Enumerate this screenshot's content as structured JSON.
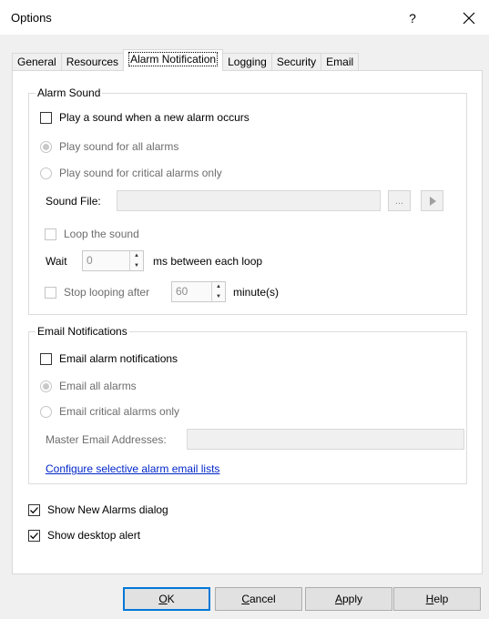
{
  "window": {
    "title": "Options",
    "help_label": "?"
  },
  "tabs": [
    {
      "label": "General"
    },
    {
      "label": "Resources"
    },
    {
      "label": "Alarm Notification"
    },
    {
      "label": "Logging"
    },
    {
      "label": "Security"
    },
    {
      "label": "Email"
    }
  ],
  "alarm_sound": {
    "group_label": "Alarm Sound",
    "play_sound_label": "Play a sound when a new alarm occurs",
    "play_sound_checked": false,
    "all_alarms_label": "Play sound for all alarms",
    "critical_only_label": "Play sound for critical alarms only",
    "sound_file_label": "Sound File:",
    "sound_file_value": "",
    "browse_label": "...",
    "play_icon": "play-icon",
    "loop_label": "Loop the sound",
    "wait_label": "Wait",
    "wait_value": "0",
    "ms_label": "ms between each loop",
    "stop_after_label": "Stop looping after",
    "stop_after_value": "60",
    "minutes_label": "minute(s)"
  },
  "email_notifications": {
    "group_label": "Email Notifications",
    "email_alarm_label": "Email alarm notifications",
    "email_alarm_checked": false,
    "email_all_label": "Email all alarms",
    "email_critical_label": "Email critical alarms only",
    "master_label": "Master Email Addresses:",
    "master_value": "",
    "configure_link": "Configure selective alarm email lists"
  },
  "show_new_alarms_label": "Show New Alarms dialog",
  "show_new_alarms_checked": true,
  "show_desktop_alert_label": "Show desktop alert",
  "show_desktop_alert_checked": true,
  "buttons": {
    "ok_accel": "O",
    "ok_rest": "K",
    "cancel_accel": "C",
    "cancel_rest": "ancel",
    "apply_accel": "A",
    "apply_rest": "pply",
    "help_accel": "H",
    "help_rest": "elp"
  },
  "colors": {
    "accent": "#0078d7",
    "link": "#0026c9",
    "background": "#f0f0f0"
  }
}
